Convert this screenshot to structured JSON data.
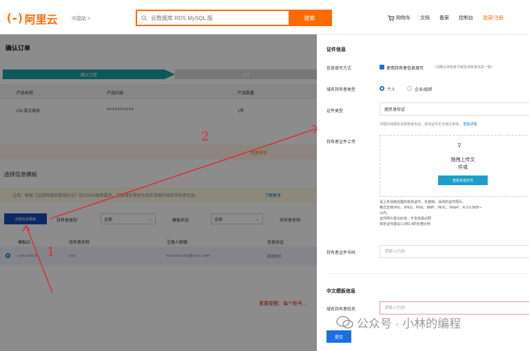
{
  "header": {
    "logo_mark": "(-)",
    "logo_text": "阿里云",
    "region": "中国站 ˅",
    "search_placeholder": "云数据库 RDS MySQL 版",
    "search_button": "搜索",
    "nav": [
      "购物车",
      "文档",
      "备案",
      "控制台"
    ],
    "login": "登录/注册"
  },
  "page": {
    "title": "确认订单",
    "steps": [
      "确认订单",
      "支付"
    ],
    "product_headers": [
      "产品名称",
      "产品内容",
      "产品数量"
    ],
    "product_row": [
      "CN 英文域名",
      "xxxxxxxxxx",
      "1年"
    ],
    "notice": "信息核实",
    "section_title": "选择信息模板",
    "tip": "注意：根据《互联网域名管理办法》及ICANN政策要求，注册域名需填写真实准确的域名持有者信息。",
    "tip_link": "了解更多",
    "create_button": "创建信息模板",
    "filters": [
      {
        "label": "持有者类型:",
        "value": "全部"
      },
      {
        "label": "模板状态:",
        "value": "全部"
      },
      {
        "label": "持有者名称:",
        "value": ""
      }
    ],
    "table_headers": [
      "模板ID",
      "持有者名称",
      "注册人邮箱",
      "信息验证"
    ],
    "table_row": [
      "xxxxxxxx",
      "xxx",
      "xxxxxxxxx@xxx.com",
      "验证成功"
    ],
    "red_note": "重要提醒：每个账号..."
  },
  "annotations": {
    "one": "1",
    "two": "2"
  },
  "panel": {
    "section1": "证件信息",
    "fill_label": "信息填写方式",
    "fill_check": "使用持有者信息填写",
    "fill_hint": "（请确认持有者与域名持有者信息一致）",
    "type_label": "域名持有者类型",
    "type_personal": "个人",
    "type_company": "企业/组织",
    "cert_label": "证件类型",
    "cert_value": "居民身份证",
    "cert_hint": "中国内地居民请使用身份证，其他证件无法通过审核。",
    "cert_hint_link": "查看详情",
    "upload_label": "持有者证件上传",
    "upload_title": "拖拽上传文",
    "upload_sub": "件或",
    "upload_button": "查看本地文件",
    "rules": [
      "请上传清晰完整的有效证件，无遮挡、涂改的证件照片。",
      "格式支持JPG、JPEG、PNG、BMP、HEIC、WebP，大小2.5KB～",
      "以内。",
      "证件照片需为彩色，不支持黑白照",
      "单张证件建议1:1到1:4的长宽比例"
    ],
    "cert_no_label": "持有者证件号码",
    "cert_no_placeholder": "请输入内容",
    "section2": "中文模板信息",
    "holder_name_label": "域名持有者姓名",
    "holder_name_placeholder": "请输入内容",
    "submit": "提交"
  },
  "watermark": "公众号 · 小林的编程"
}
